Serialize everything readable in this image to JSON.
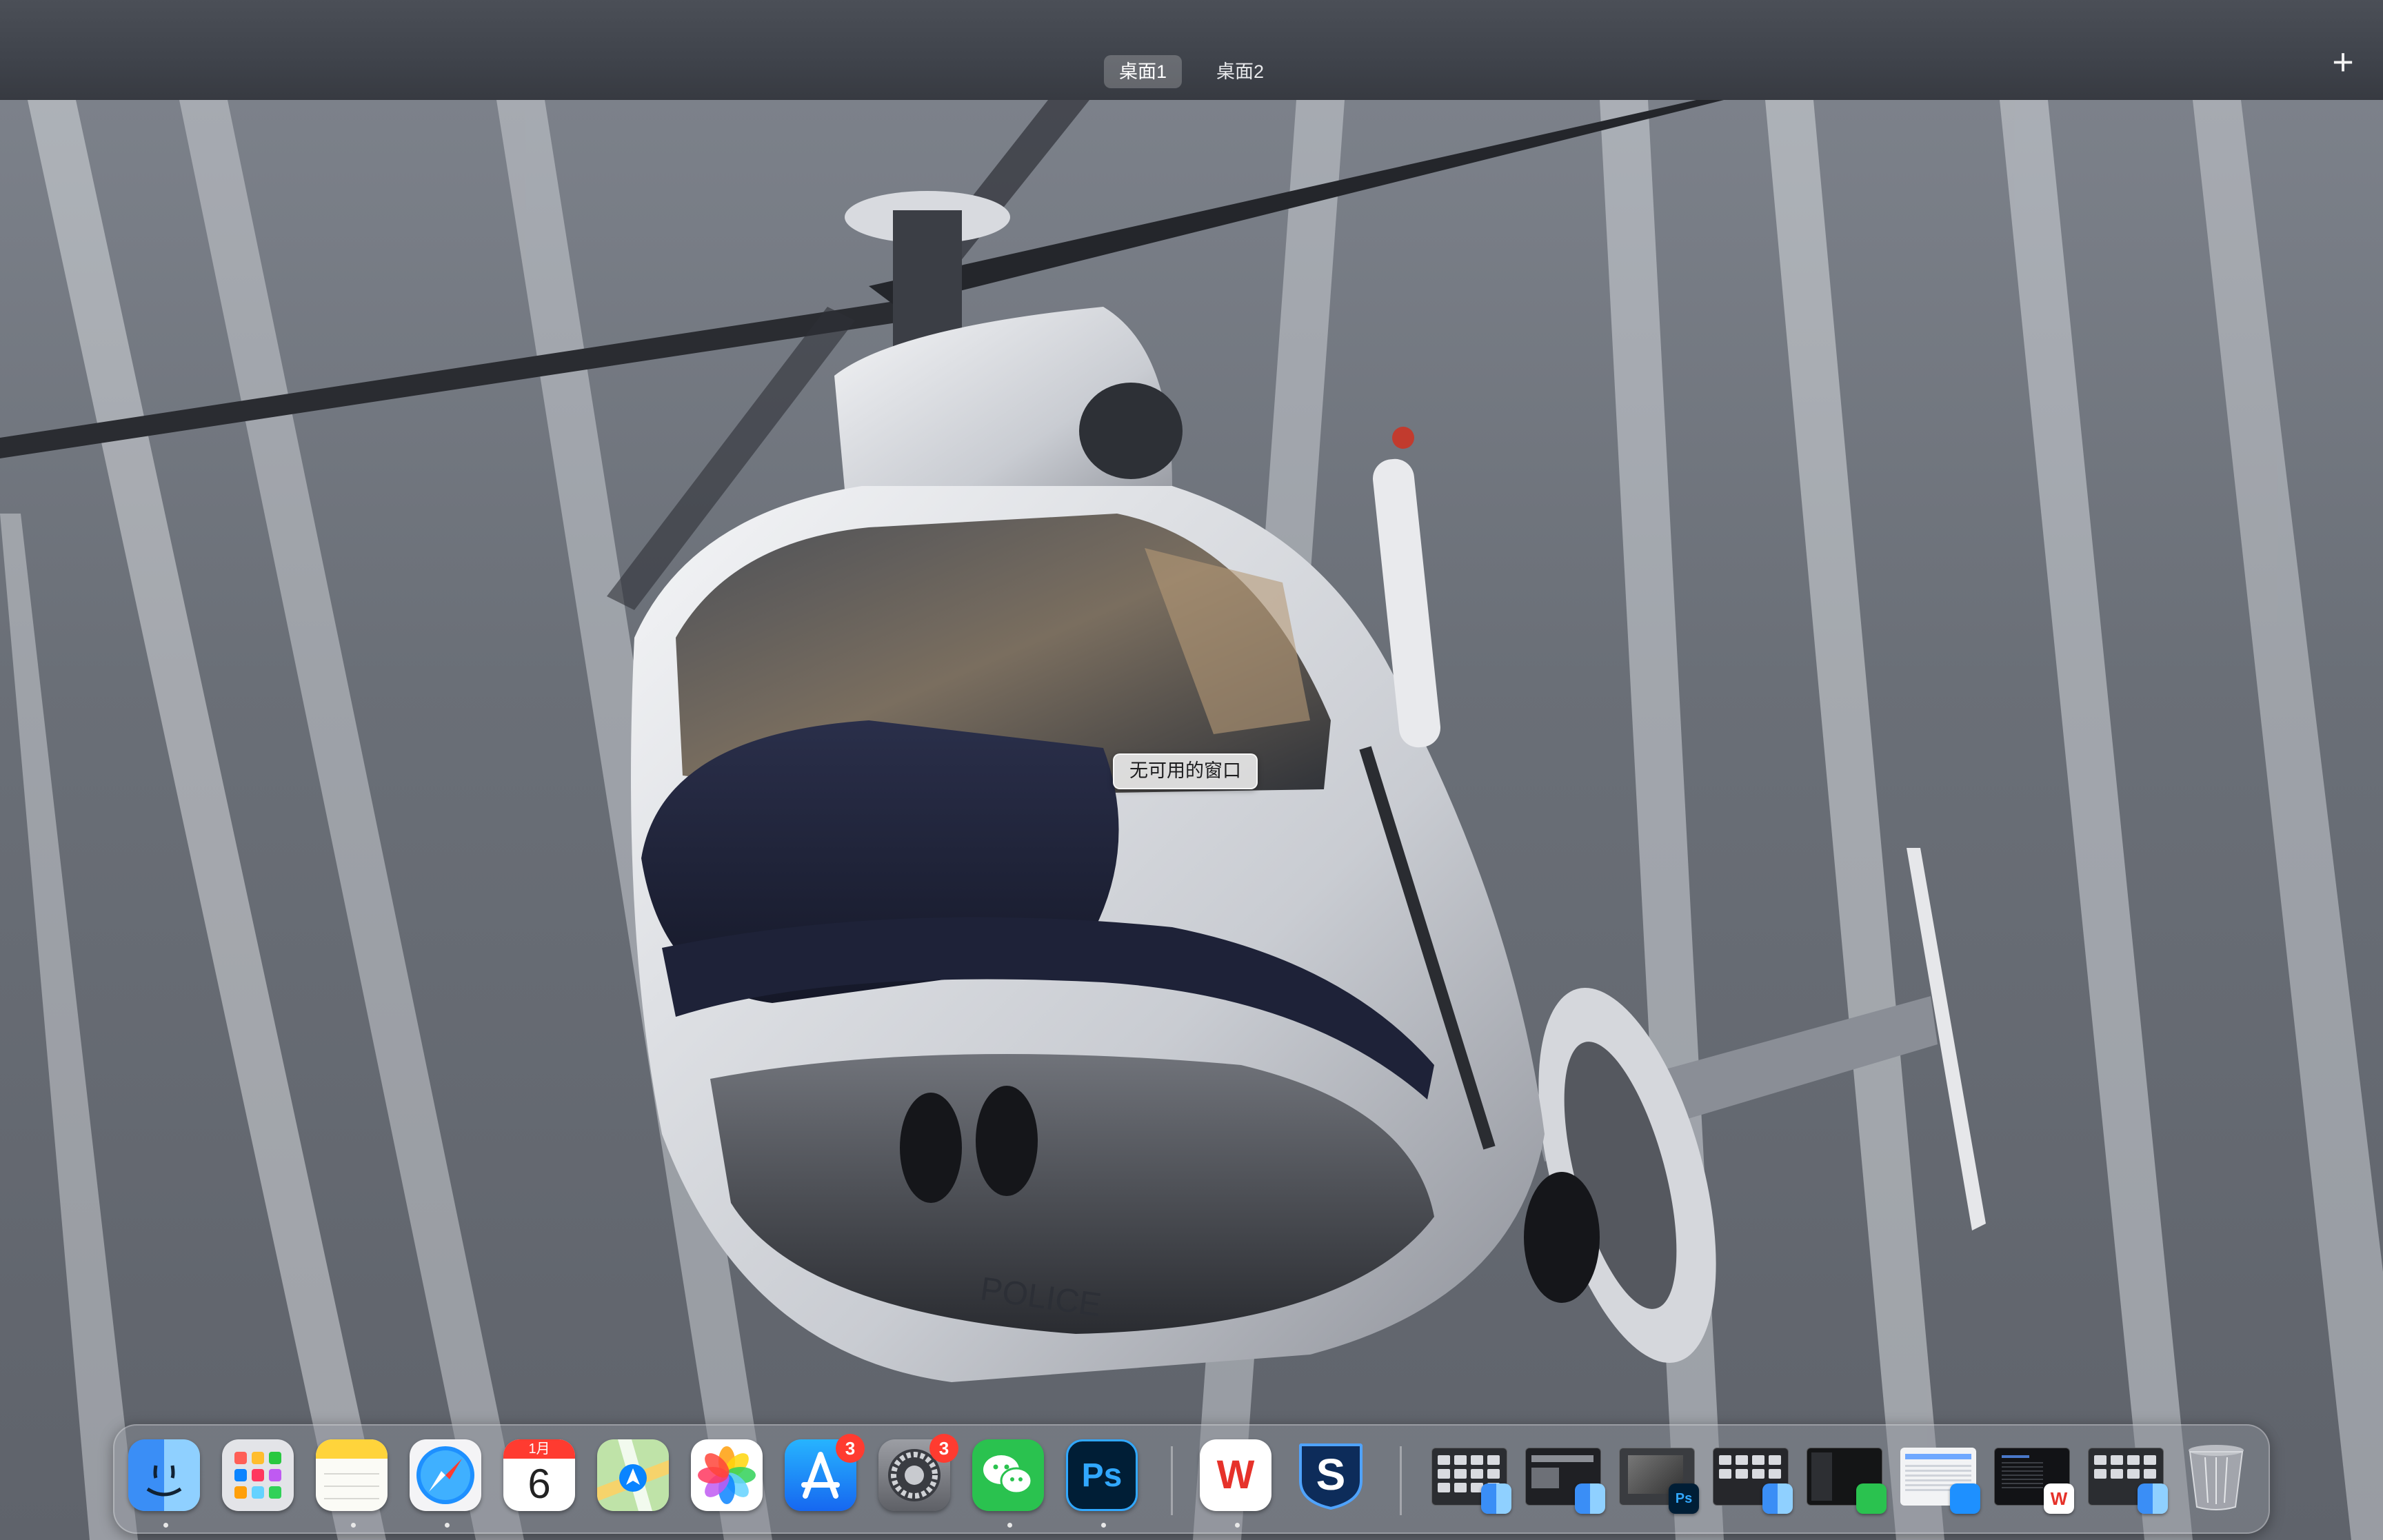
{
  "spaces": {
    "tabs": [
      {
        "label": "桌面1",
        "active": true
      },
      {
        "label": "桌面2",
        "active": false
      }
    ],
    "add_symbol": "+"
  },
  "desktop": {
    "no_windows_label": "无可用的窗口",
    "wallpaper_text": "POLICE"
  },
  "dock": {
    "apps": [
      {
        "name": "finder",
        "icon": "finder-icon",
        "running": true
      },
      {
        "name": "launchpad",
        "icon": "launchpad-icon",
        "running": false
      },
      {
        "name": "notes",
        "icon": "notes-icon",
        "running": true
      },
      {
        "name": "safari",
        "icon": "safari-icon",
        "running": true
      },
      {
        "name": "calendar",
        "icon": "calendar-icon",
        "running": false,
        "month": "1月",
        "day": "6"
      },
      {
        "name": "maps",
        "icon": "maps-icon",
        "running": false
      },
      {
        "name": "photos",
        "icon": "photos-icon",
        "running": false
      },
      {
        "name": "app-store",
        "icon": "app-store-icon",
        "running": false,
        "badge": "3"
      },
      {
        "name": "system-settings",
        "icon": "gear-icon",
        "running": false,
        "badge": "3"
      },
      {
        "name": "wechat",
        "icon": "wechat-icon",
        "running": true
      },
      {
        "name": "photoshop",
        "icon": "photoshop-icon",
        "running": true,
        "text": "Ps"
      },
      {
        "name": "wps-office",
        "icon": "wps-icon",
        "running": true,
        "text": "W"
      },
      {
        "name": "setapp",
        "icon": "s-icon",
        "running": false,
        "text": "S"
      }
    ],
    "ps_mini_text": "Ps",
    "wps_mini_text": "W"
  },
  "colors": {
    "badge": "#ff3b30",
    "dock_bg": "rgba(140,145,152,0.45)",
    "active_tab": "rgba(255,255,255,0.22)"
  }
}
